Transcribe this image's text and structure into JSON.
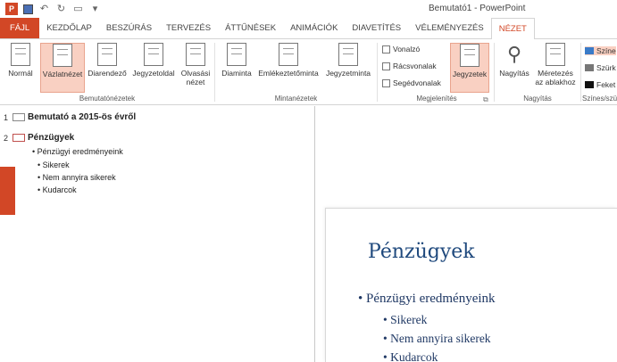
{
  "window": {
    "title": "Bemutató1 - PowerPoint",
    "app_icon": "P"
  },
  "tabs": [
    "FÁJL",
    "KEZDŐLAP",
    "BESZÚRÁS",
    "TERVEZÉS",
    "ÁTTŰNÉSEK",
    "ANIMÁCIÓK",
    "DIAVETÍTÉS",
    "VÉLEMÉNYEZÉS",
    "NÉZET"
  ],
  "active_tab": "NÉZET",
  "ribbon": {
    "bemutato_nezetek": {
      "label": "Bemutatónézetek",
      "buttons": [
        "Normál",
        "Vázlatnézet",
        "Diarendező",
        "Jegyzetoldal",
        "Olvasási",
        "nézet"
      ],
      "selected": "Vázlatnézet"
    },
    "minta_nezetek": {
      "label": "Mintanézetek",
      "buttons": [
        "Diaminta",
        "Emlékeztetőminta",
        "Jegyzetminta"
      ]
    },
    "megjelenites": {
      "label": "Megjelenítés",
      "checkboxes": [
        "Vonalzó",
        "Rácsvonalak",
        "Segédvonalak"
      ],
      "jegyzetek": "Jegyzetek"
    },
    "nagyitas": {
      "label": "Nagyítás",
      "buttons": [
        "Nagyítás",
        "Méretezés",
        "az ablakhoz"
      ]
    },
    "szines": {
      "label": "Színes/szü",
      "items": [
        "Színe",
        "Szürk",
        "Feket"
      ]
    }
  },
  "outline": {
    "slides": [
      {
        "num": "1",
        "title": "Bemutató a 2015-ös évről"
      },
      {
        "num": "2",
        "title": "Pénzügyek"
      }
    ],
    "bullets": [
      "• Pénzügyi eredményeink",
      "• Sikerek",
      "• Nem annyira sikerek",
      "• Kudarcok"
    ]
  },
  "slide": {
    "title": "Pénzügyek",
    "l1": "• Pénzügyi eredményeink",
    "l2": [
      "• Sikerek",
      "• Nem annyira sikerek",
      "• Kudarcok"
    ]
  },
  "colors": {
    "accent": "#d24726",
    "selected_bg": "#f9d0c2",
    "slide_title": "#1f497d"
  }
}
